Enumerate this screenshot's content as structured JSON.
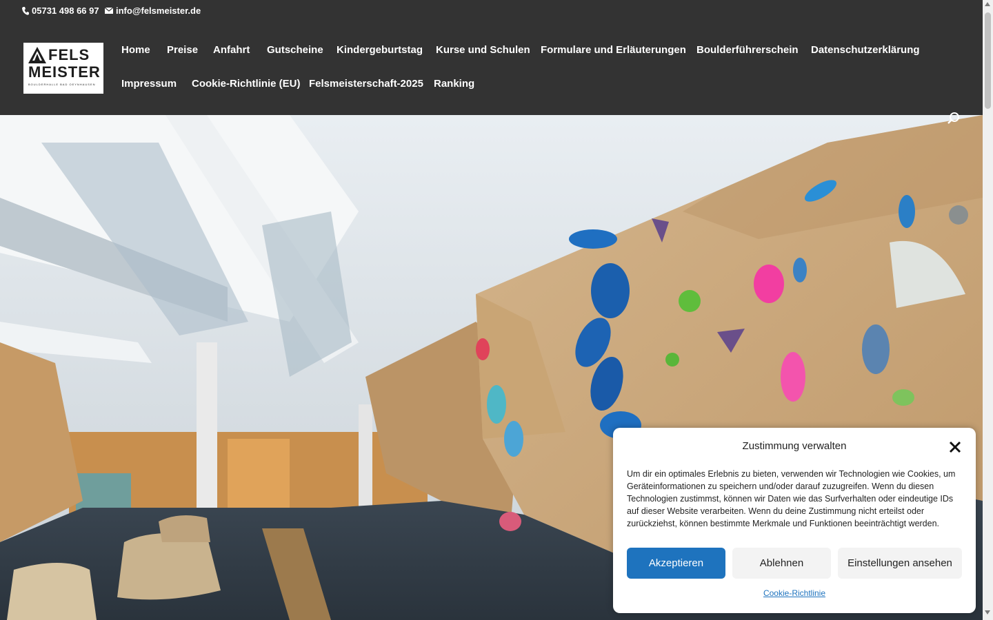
{
  "topbar": {
    "phone": "05731 498 66 97",
    "email": "info@felsmeister.de"
  },
  "logo": {
    "line1": "FELS",
    "line2": "MEISTER",
    "tagline": "BOULDERHALLE BAD OEYNHAUSEN"
  },
  "nav": {
    "items": [
      "Home",
      "Preise",
      "Anfahrt",
      "Gutscheine",
      "Kindergeburtstag",
      "Kurse und Schulen",
      "Formulare und Erläuterungen",
      "Boulderführerschein",
      "Datenschutzerklärung",
      "Impressum",
      "Cookie-Richtlinie (EU)",
      "Felsmeisterschaft-2025",
      "Ranking"
    ]
  },
  "consent": {
    "title": "Zustimmung verwalten",
    "body": "Um dir ein optimales Erlebnis zu bieten, verwenden wir Technologien wie Cookies, um Geräteinformationen zu speichern und/oder darauf zuzugreifen. Wenn du diesen Technologien zustimmst, können wir Daten wie das Surfverhalten oder eindeutige IDs auf dieser Website verarbeiten. Wenn du deine Zustimmung nicht erteilst oder zurückziehst, können bestimmte Merkmale und Funktionen beeinträchtigt werden.",
    "accept": "Akzeptieren",
    "deny": "Ablehnen",
    "preferences": "Einstellungen ansehen",
    "policy_link": "Cookie-Richtlinie"
  },
  "colors": {
    "header_bg": "#333333",
    "accent": "#1e73be"
  },
  "icons": {
    "phone": "phone-icon",
    "email": "envelope-icon",
    "search": "search-icon",
    "close": "close-icon"
  }
}
